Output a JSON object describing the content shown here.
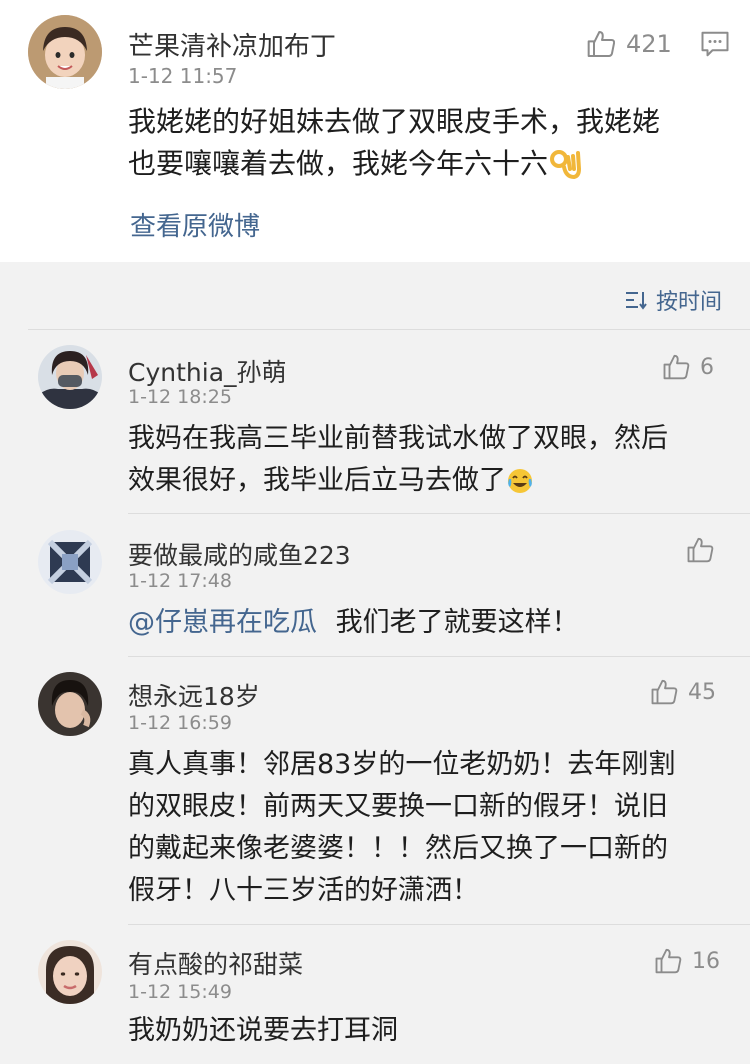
{
  "main_post": {
    "username": "芒果清补凉加布丁",
    "time": "1-12 11:57",
    "likes": "421",
    "line1": "我姥姥的好姐妹去做了双眼皮手术，我姥姥",
    "line2": "也要嚷嚷着去做，我姥今年六十六",
    "view_original": "查看原微博"
  },
  "sort": {
    "label": "按时间"
  },
  "comments": [
    {
      "username": "Cynthia_孙萌",
      "time": "1-12 18:25",
      "likes": "6",
      "lines": [
        "我妈在我高三毕业前替我试水做了双眼，然后",
        "效果很好，我毕业后立马去做了"
      ]
    },
    {
      "username": "要做最咸的咸鱼223",
      "time": "1-12 17:48",
      "likes": "",
      "mention": "@仔崽再在吃瓜",
      "text": "我们老了就要这样！"
    },
    {
      "username": "想永远18岁",
      "time": "1-12 16:59",
      "likes": "45",
      "lines": [
        "真人真事！邻居83岁的一位老奶奶！去年刚割",
        "的双眼皮！前两天又要换一口新的假牙！说旧",
        "的戴起来像老婆婆！！！然后又换了一口新的",
        "假牙！八十三岁活的好潇洒！"
      ]
    },
    {
      "username": "有点酸的祁甜菜",
      "time": "1-12 15:49",
      "likes": "16",
      "lines": [
        "我奶奶还说要去打耳洞"
      ]
    }
  ]
}
